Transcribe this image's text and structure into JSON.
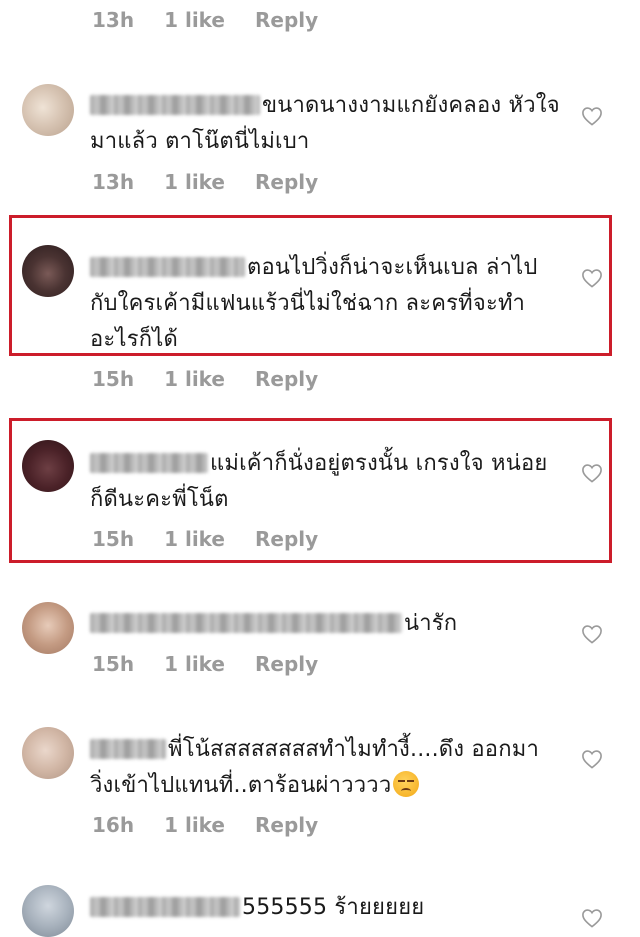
{
  "comments": [
    {
      "text": "",
      "time": "13h",
      "likes": "1 like",
      "reply": "Reply"
    },
    {
      "text": "ขนาดนางงามแกยังคลอง หัวใจมาแล้ว ตาโน๊ตนี่ไม่เบา",
      "time": "13h",
      "likes": "1 like",
      "reply": "Reply"
    },
    {
      "text": "ตอนไปวิ่งก็น่าจะเห็นเบล ล่าไปกับใครเค้ามีแฟนแร้วนี่ไม่ใช่ฉาก ละครที่จะทำอะไรก็ได้",
      "time": "15h",
      "likes": "1 like",
      "reply": "Reply",
      "highlighted": true
    },
    {
      "text": "แม่เค้าก็นั่งอยู่ตรงนั้น เกรงใจ หน่อยก็ดีนะคะพี่โน็ต",
      "time": "15h",
      "likes": "1 like",
      "reply": "Reply",
      "highlighted": true
    },
    {
      "text": "น่ารัก",
      "time": "15h",
      "likes": "1 like",
      "reply": "Reply"
    },
    {
      "text": "พี่โน้สสสสสสสสทำไมทำงี้....ดึง ออกมาวิ่งเข้าไปแทนที่..ตาร้อนผ่าวววว",
      "emoji": "unamused-face",
      "time": "16h",
      "likes": "1 like",
      "reply": "Reply"
    },
    {
      "text": "555555 ร้ายยยยย"
    }
  ],
  "icons": {
    "like": "heart-outline-icon"
  },
  "colors": {
    "highlight_border": "#cc1d2a",
    "meta_text": "#9a9a9a"
  }
}
